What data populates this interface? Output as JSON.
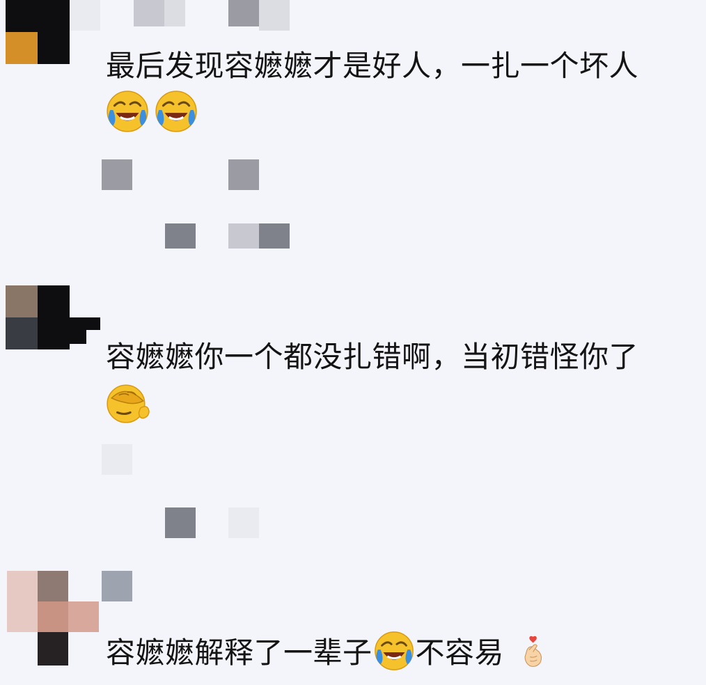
{
  "comments": [
    {
      "text": "最后发现容嬷嬷才是好人，一扎一个坏人",
      "emojis": [
        "laughing-crying-icon",
        "laughing-crying-icon"
      ]
    },
    {
      "text": "容嬷嬷你一个都没扎错啊，当初错怪你了",
      "emojis": [
        "facepalm-icon"
      ]
    },
    {
      "text_before": "容嬷嬷解释了一辈子",
      "inline_emoji": "laughing-crying-icon",
      "text_after": "不容易",
      "trailing_emoji": "finger-heart-icon"
    }
  ],
  "colors": {
    "background": "#f4f5fa",
    "text": "#141414",
    "emoji_yellow": "#f6c22c",
    "tear_blue": "#3a8fe0"
  }
}
